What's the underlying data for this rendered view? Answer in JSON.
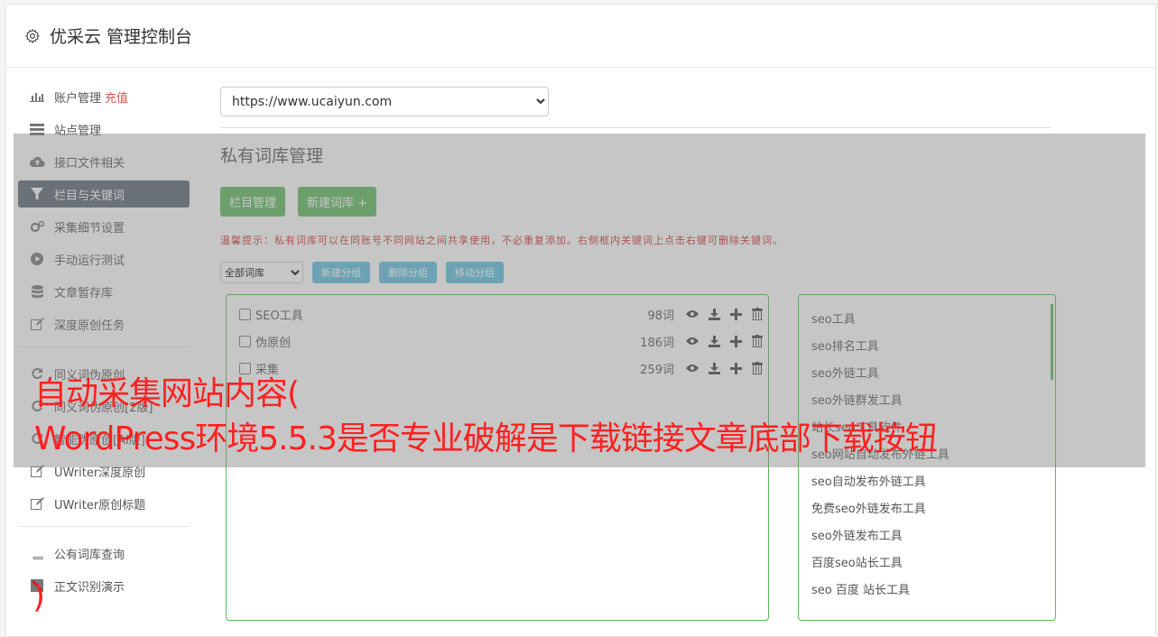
{
  "header": {
    "title": "优采云 管理控制台",
    "icon": "gear-icon"
  },
  "sidebar": {
    "items": [
      {
        "label": "账户管理",
        "badge": "充值",
        "icon": "bar-chart-icon"
      },
      {
        "label": "站点管理",
        "icon": "server-icon"
      },
      {
        "label": "接口文件相关",
        "icon": "cloud-upload-icon"
      },
      {
        "label": "栏目与关键词",
        "icon": "filter-icon",
        "active": true
      },
      {
        "label": "采集细节设置",
        "icon": "cogs-icon"
      },
      {
        "label": "手动运行测试",
        "icon": "play-icon"
      },
      {
        "label": "文章暂存库",
        "icon": "database-icon"
      },
      {
        "label": "深度原创任务",
        "icon": "edit-icon"
      }
    ],
    "items2": [
      {
        "label": "同义词伪原创[2版]",
        "icon": "refresh-icon"
      },
      {
        "label": "智能伪原创[AI版]",
        "icon": "refresh-icon"
      },
      {
        "label": "UWriter深度原创",
        "icon": "edit-icon"
      },
      {
        "label": "UWriter原创标题",
        "icon": "edit-icon"
      }
    ],
    "items3": [
      {
        "label": "公有词库查询",
        "icon": "book-icon"
      },
      {
        "label": "正文识别演示",
        "icon": "bookmark-icon"
      }
    ]
  },
  "main": {
    "site_select": "https://www.ucaiyun.com",
    "section_title": "私有词库管理",
    "btn_columns": "栏目管理",
    "btn_new_lib": "新建词库 +",
    "tip": "温馨提示：私有词库可以在同账号不同网站之间共享使用，不必重复添加。右侧框内关键词上点击右键可删除关键词。",
    "lib_filter": "全部词库",
    "btn_new_group": "新建分组",
    "btn_delete_group": "删除分组",
    "btn_move_group": "移动分组",
    "libraries": [
      {
        "name": "SEO工具",
        "count": "98词"
      },
      {
        "name": "伪原创",
        "count": "186词"
      },
      {
        "name": "采集",
        "count": "259词"
      }
    ],
    "keywords": [
      "seo工具",
      "seo排名工具",
      "seo外链工具",
      "seo外链群发工具",
      "站长seo工具软件",
      "seo网站自动发布外链工具",
      "seo自动发布外链工具",
      "免费seo外链发布工具",
      "seo外链发布工具",
      "百度seo站长工具",
      "seo 百度 站长工具"
    ]
  },
  "overlay": {
    "line1": "自动采集网站内容(",
    "line2": "WordPress环境5.5.3是否专业破解是下载链接文章底部下载按钮",
    "line3": ")"
  },
  "colors": {
    "accent_green": "#5cb85c",
    "accent_blue": "#5bc0de",
    "tip_red": "#c9302c",
    "overlay_red": "#ff2020",
    "active_nav": "#5a6472"
  }
}
